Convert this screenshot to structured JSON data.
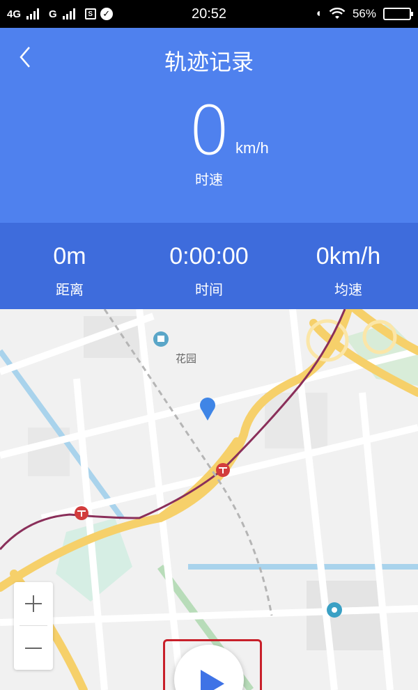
{
  "status_bar": {
    "network1": "4G",
    "network2": "G",
    "time": "20:52",
    "battery": "56%",
    "sim_badge": "S",
    "icons": [
      "signal-icon",
      "moon-icon",
      "wifi-icon",
      "battery-icon",
      "check-icon"
    ]
  },
  "header": {
    "title": "轨迹记录",
    "speed_value": "0",
    "speed_unit": "km/h",
    "speed_label": "时速"
  },
  "stats": [
    {
      "value": "0m",
      "label": "距离"
    },
    {
      "value": "0:00:00",
      "label": "时间"
    },
    {
      "value": "0km/h",
      "label": "均速"
    }
  ],
  "map": {
    "place_label": "花园"
  },
  "colors": {
    "header_bg": "#4f81ee",
    "stats_bg": "#3e6cdc",
    "accent": "#3f73e6",
    "highlight": "#c8202a"
  }
}
